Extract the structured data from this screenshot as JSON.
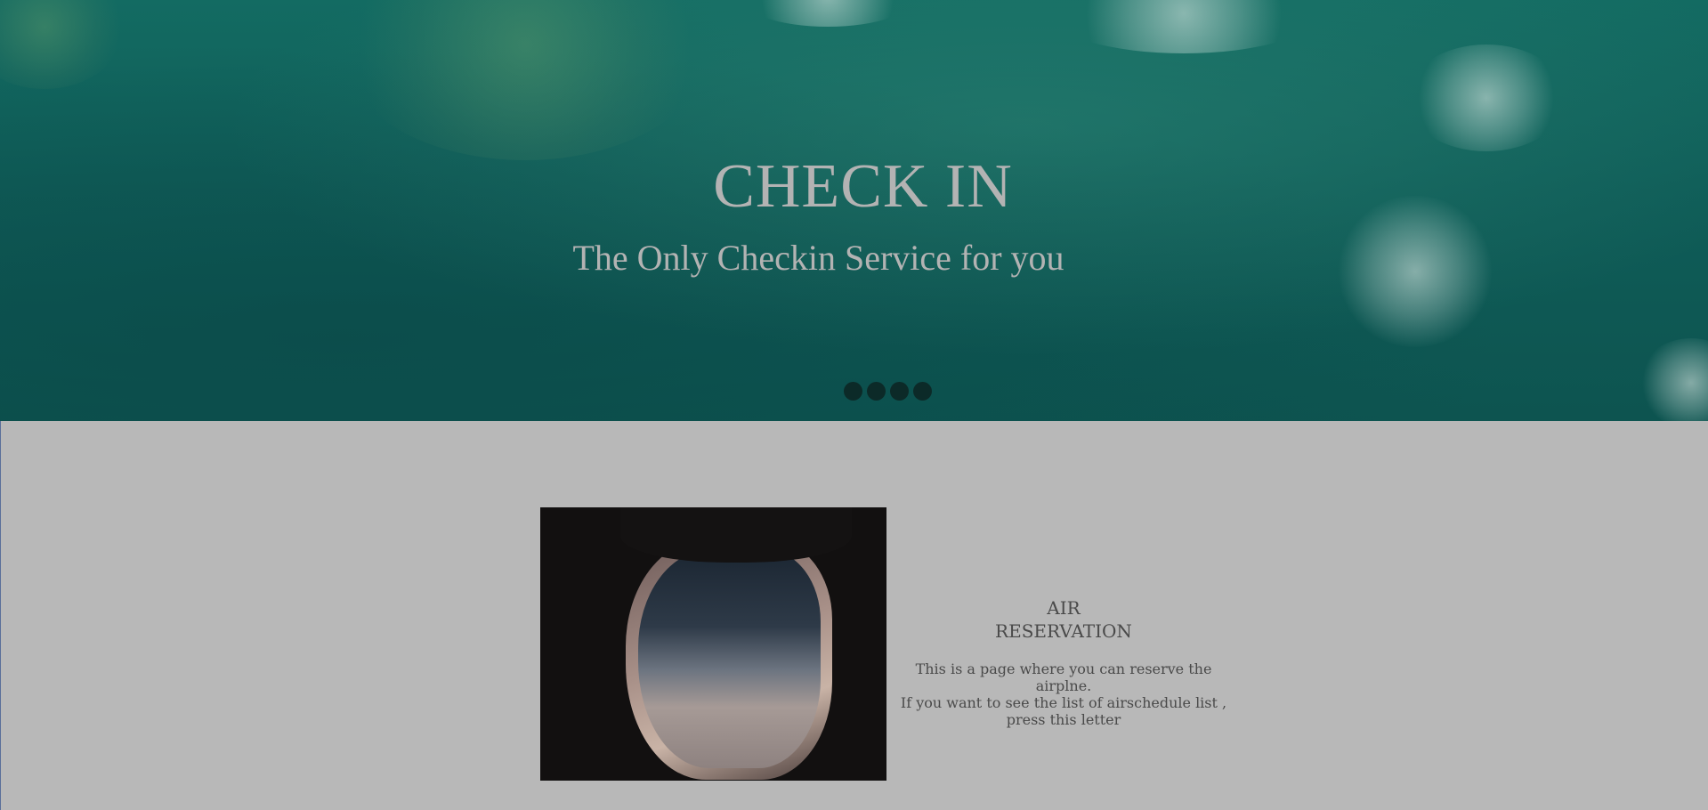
{
  "hero": {
    "title": "CHECK IN",
    "subtitle": "The Only Checkin Service for you",
    "slide_count": 4
  },
  "reservation": {
    "title": "AIR RESERVATION",
    "description_line1": "This is a page where you can reserve the airplne.",
    "description_line2": "If you want to see the list of airschedule list ,",
    "description_line3": "press this letter"
  },
  "colors": {
    "hero_sea": "#136b62",
    "page_background": "#b8b8b8",
    "heading_text": "#b3b3b3",
    "body_text": "#4a4a4a"
  }
}
